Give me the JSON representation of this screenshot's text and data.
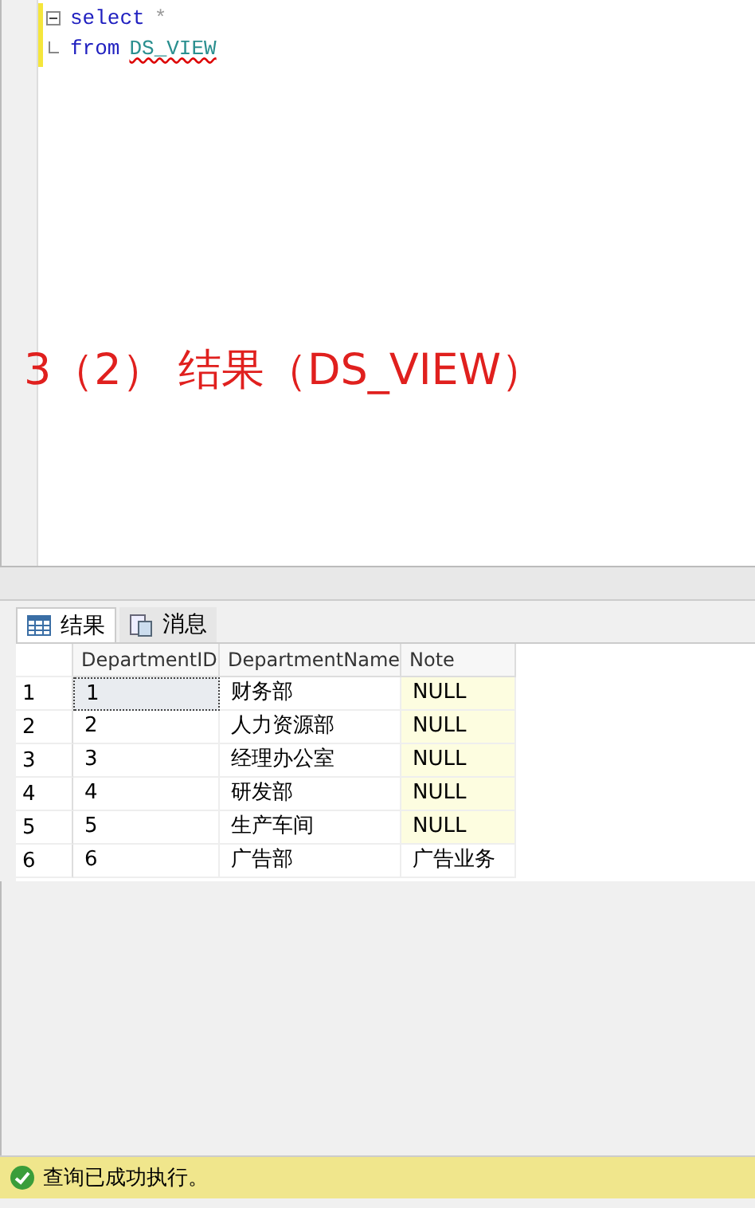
{
  "editor": {
    "lines": [
      {
        "collapsible": true,
        "tokens": [
          {
            "text": "select",
            "kind": "keyword",
            "error": false
          },
          {
            "text": "*",
            "kind": "operator",
            "error": false
          }
        ]
      },
      {
        "collapsible": false,
        "tokens": [
          {
            "text": "from",
            "kind": "keyword",
            "error": false
          },
          {
            "text": "DS_VIEW",
            "kind": "identifier",
            "error": true
          }
        ]
      }
    ],
    "annotation": "3（2）  结果（DS_VIEW）"
  },
  "tabs": [
    {
      "label": "结果",
      "kind": "grid",
      "selected": true
    },
    {
      "label": "消息",
      "kind": "messages",
      "selected": false
    }
  ],
  "table": {
    "columns": [
      "DepartmentID",
      "DepartmentName",
      "Note"
    ],
    "rows": [
      {
        "number": "1",
        "cells": [
          {
            "text": "1",
            "selected": true,
            "null": false
          },
          {
            "text": "财务部",
            "selected": false,
            "null": false
          },
          {
            "text": "NULL",
            "selected": false,
            "null": true
          }
        ]
      },
      {
        "number": "2",
        "cells": [
          {
            "text": "2",
            "selected": false,
            "null": false
          },
          {
            "text": "人力资源部",
            "selected": false,
            "null": false
          },
          {
            "text": "NULL",
            "selected": false,
            "null": true
          }
        ]
      },
      {
        "number": "3",
        "cells": [
          {
            "text": "3",
            "selected": false,
            "null": false
          },
          {
            "text": "经理办公室",
            "selected": false,
            "null": false
          },
          {
            "text": "NULL",
            "selected": false,
            "null": true
          }
        ]
      },
      {
        "number": "4",
        "cells": [
          {
            "text": "4",
            "selected": false,
            "null": false
          },
          {
            "text": "研发部",
            "selected": false,
            "null": false
          },
          {
            "text": "NULL",
            "selected": false,
            "null": true
          }
        ]
      },
      {
        "number": "5",
        "cells": [
          {
            "text": "5",
            "selected": false,
            "null": false
          },
          {
            "text": "生产车间",
            "selected": false,
            "null": false
          },
          {
            "text": "NULL",
            "selected": false,
            "null": true
          }
        ]
      },
      {
        "number": "6",
        "cells": [
          {
            "text": "6",
            "selected": false,
            "null": false
          },
          {
            "text": "广告部",
            "selected": false,
            "null": false
          },
          {
            "text": "广告业务",
            "selected": false,
            "null": false
          }
        ]
      }
    ]
  },
  "status_bar": {
    "message": "查询已成功执行。"
  }
}
